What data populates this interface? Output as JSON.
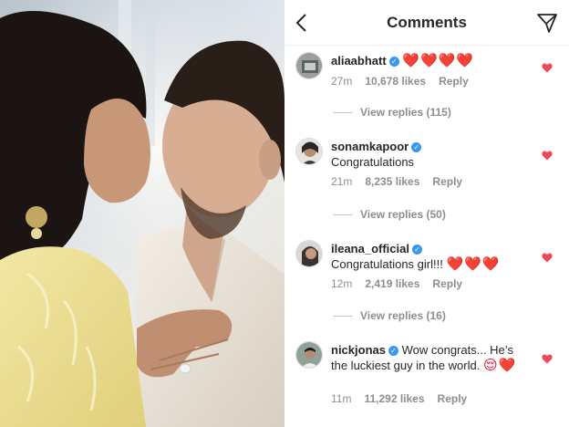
{
  "header": {
    "title": "Comments"
  },
  "comments": [
    {
      "username": "aliaabhatt",
      "verified": true,
      "text": "",
      "emoji": "❤️❤️❤️❤️",
      "time": "27m",
      "likes": "10,678 likes",
      "reply_label": "Reply",
      "view_replies": "View replies (115)",
      "liked": true
    },
    {
      "username": "sonamkapoor",
      "verified": true,
      "text": "Congratulations",
      "emoji": "",
      "time": "21m",
      "likes": "8,235 likes",
      "reply_label": "Reply",
      "view_replies": "View replies (50)",
      "liked": true
    },
    {
      "username": "ileana_official",
      "verified": true,
      "text": "Congratulations girl!!!",
      "emoji": "❤️❤️❤️",
      "time": "12m",
      "likes": "2,419 likes",
      "reply_label": "Reply",
      "view_replies": "View replies (16)",
      "liked": true
    },
    {
      "username": "nickjonas",
      "verified": true,
      "text": "Wow congrats... He’s the luckiest guy in the world.",
      "emoji": "😌❤️",
      "time": "11m",
      "likes": "11,292 likes",
      "reply_label": "Reply",
      "view_replies": "",
      "liked": true
    }
  ],
  "colors": {
    "like_red": "#ed4956",
    "verified_blue": "#3897f0",
    "meta_gray": "#8e8e8e",
    "text": "#262626"
  },
  "icons": {
    "back": "chevron-left-icon",
    "send": "paper-plane-icon",
    "like": "heart-icon",
    "verified": "verified-badge-icon"
  }
}
